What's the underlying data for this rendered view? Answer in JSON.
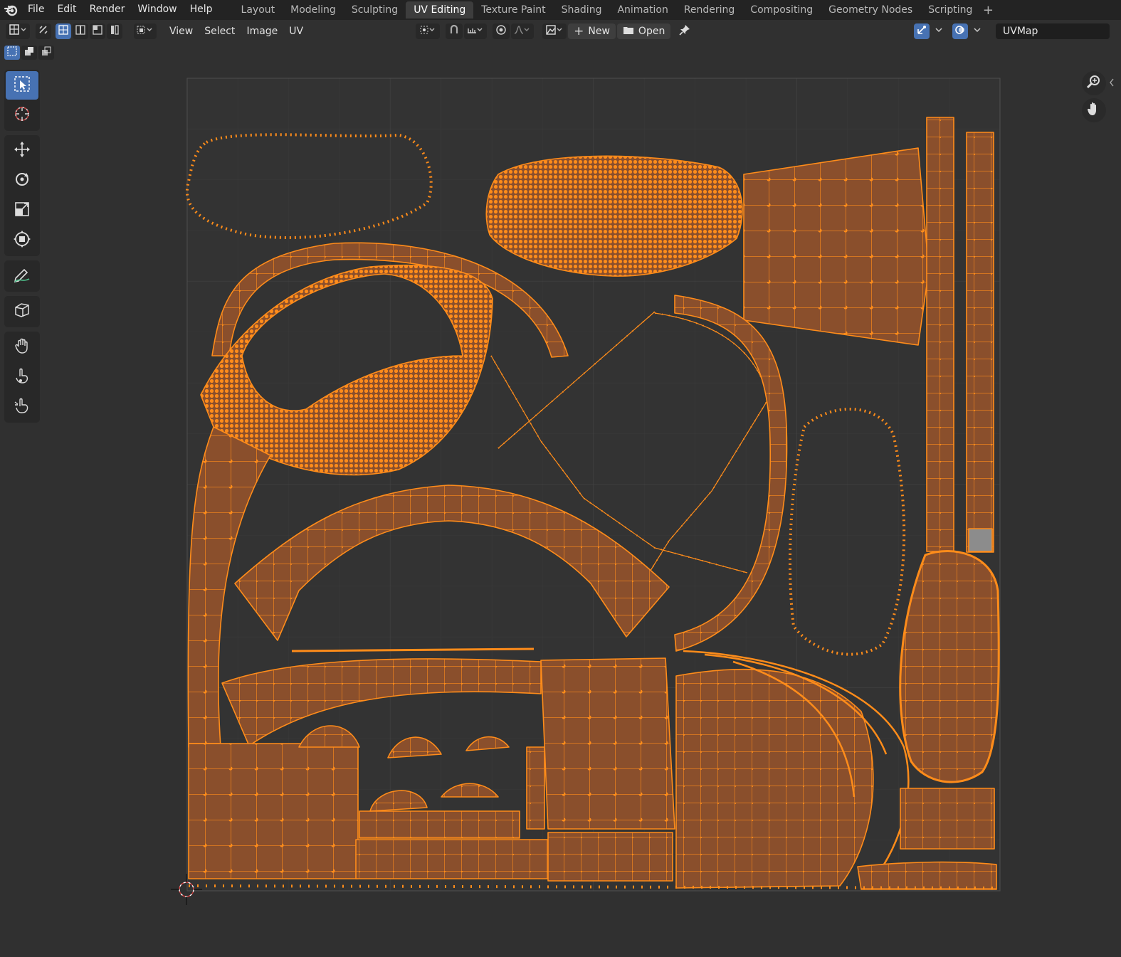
{
  "topbar": {
    "menus": [
      "File",
      "Edit",
      "Render",
      "Window",
      "Help"
    ],
    "workspaces": [
      "Layout",
      "Modeling",
      "Sculpting",
      "UV Editing",
      "Texture Paint",
      "Shading",
      "Animation",
      "Rendering",
      "Compositing",
      "Geometry Nodes",
      "Scripting"
    ],
    "active_workspace": "UV Editing",
    "add_workspace_label": "+"
  },
  "header": {
    "menus": [
      "View",
      "Select",
      "Image",
      "UV"
    ],
    "new_label": "New",
    "open_label": "Open",
    "uvmap_value": "UVMap"
  },
  "icons": {
    "logo": "blender-logo-icon",
    "editor_type": "uv-editor-icon",
    "sync": "uv-sync-selection-icon",
    "pivot": "pivot-point-icon",
    "snap": "snap-icon",
    "proportional": "proportional-editing-icon",
    "image_browse": "image-browse-icon",
    "pin": "pin-icon",
    "gizmo": "gizmo-icon",
    "overlay": "overlay-icon",
    "zoom": "zoom-icon",
    "hand": "pan-hand-icon"
  },
  "toolbar": {
    "tools": [
      "tweak",
      "cursor",
      "move",
      "rotate",
      "scale",
      "transform",
      "annotate",
      "rip",
      "grab",
      "relax",
      "pinch"
    ]
  },
  "colors": {
    "accent_blue": "#4772b3",
    "uv_edge": "#ff8c1a",
    "uv_face": "#8a4f2c",
    "background": "#303030",
    "grid_line": "#3b3b3b",
    "selected_face_gray": "#8c8c8c"
  }
}
